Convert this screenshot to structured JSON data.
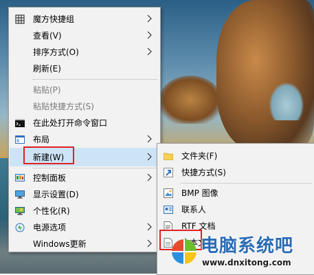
{
  "main_menu": {
    "items": [
      {
        "label": "魔方快捷组",
        "icon": "grid-icon",
        "has_submenu": true
      },
      {
        "label": "查看(V)",
        "icon": "",
        "has_submenu": true
      },
      {
        "label": "排序方式(O)",
        "icon": "",
        "has_submenu": true
      },
      {
        "label": "刷新(E)",
        "icon": "",
        "has_submenu": false
      },
      {
        "label": "粘贴(P)",
        "icon": "",
        "has_submenu": false,
        "disabled": true
      },
      {
        "label": "粘贴快捷方式(S)",
        "icon": "",
        "has_submenu": false,
        "disabled": true
      },
      {
        "label": "在此处打开命令窗口",
        "icon": "cmd-icon",
        "has_submenu": false
      },
      {
        "label": "布局",
        "icon": "layout-icon",
        "has_submenu": true
      },
      {
        "label": "新建(W)",
        "icon": "",
        "has_submenu": true,
        "highlighted": true
      },
      {
        "label": "控制面板",
        "icon": "control-panel-icon",
        "has_submenu": true
      },
      {
        "label": "显示设置(D)",
        "icon": "display-icon",
        "has_submenu": false
      },
      {
        "label": "个性化(R)",
        "icon": "personalize-icon",
        "has_submenu": false
      },
      {
        "label": "电源选项",
        "icon": "power-icon",
        "has_submenu": true
      },
      {
        "label": "Windows更新",
        "icon": "",
        "has_submenu": true
      }
    ]
  },
  "new_submenu": {
    "items": [
      {
        "label": "文件夹(F)",
        "icon": "folder-icon"
      },
      {
        "label": "快捷方式(S)",
        "icon": "shortcut-icon"
      },
      {
        "label": "BMP 图像",
        "icon": "bmp-icon"
      },
      {
        "label": "联系人",
        "icon": "contact-icon"
      },
      {
        "label": "RTF 文档",
        "icon": "rtf-icon"
      },
      {
        "label": "文本文档",
        "icon": "text-doc-icon"
      }
    ]
  },
  "watermark": {
    "title": "电脑系统吧",
    "url": "www.dnxitong.com"
  },
  "colors": {
    "highlight": "#cde4f7",
    "menu_bg": "#f2f2f2",
    "annotation_red": "#e02020",
    "watermark_blue": "#2a6bb5"
  }
}
